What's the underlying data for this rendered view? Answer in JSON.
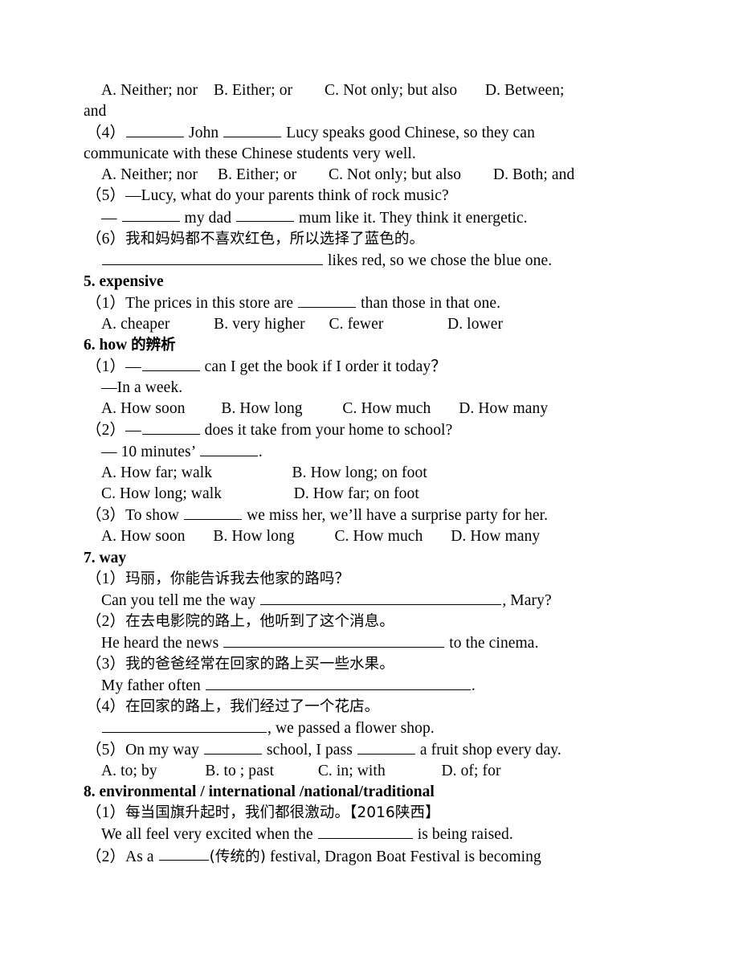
{
  "document": {
    "type": "english-grammar-worksheet",
    "lines": [
      {
        "id": "l1",
        "kind": "options",
        "text": "A. Neither; nor    B. Either; or        C. Not only; but also       D. Between;"
      },
      {
        "id": "l2",
        "kind": "wrap",
        "text": "and"
      },
      {
        "id": "l3",
        "kind": "item",
        "num": "（4）",
        "pre": "",
        "mid": " John ",
        "post": " Lucy speaks good Chinese, so they can"
      },
      {
        "id": "l4",
        "kind": "wrap",
        "text": "communicate with these Chinese students very well."
      },
      {
        "id": "l5",
        "kind": "options",
        "text": "A. Neither; nor     B. Either; or        C. Not only; but also        D. Both; and"
      },
      {
        "id": "l6",
        "kind": "item",
        "num": "（5）",
        "text": "—Lucy, what do your parents think of rock music?"
      },
      {
        "id": "l7",
        "kind": "dialog",
        "pre": "— ",
        "mid": " my dad ",
        "post": " mum like it. They think it energetic."
      },
      {
        "id": "l8",
        "kind": "item-cjk",
        "num": "（6）",
        "text": "我和妈妈都不喜欢红色，所以选择了蓝色的。"
      },
      {
        "id": "l9",
        "kind": "blank-answer",
        "post": " likes red, so we chose the blue one."
      },
      {
        "id": "h5",
        "kind": "heading",
        "text": "5. expensive"
      },
      {
        "id": "l10",
        "kind": "item",
        "num": "（1）",
        "pre": "The prices in this store are ",
        "post": " than those in that one."
      },
      {
        "id": "l11",
        "kind": "options",
        "text": "A. cheaper           B. very higher      C. fewer                D. lower"
      },
      {
        "id": "h6",
        "kind": "heading-mixed",
        "en": "6. how ",
        "cjk": "的辨析"
      },
      {
        "id": "l12",
        "kind": "item",
        "num": "（1）",
        "pre": "—",
        "post": " can I get the book if I order it today？"
      },
      {
        "id": "l13",
        "kind": "cont",
        "text": "—In a week."
      },
      {
        "id": "l14",
        "kind": "options",
        "text": "A. How soon         B. How long          C. How much       D. How many"
      },
      {
        "id": "l15",
        "kind": "item",
        "num": "（2）",
        "pre": "—",
        "post": " does it take from your home to school?"
      },
      {
        "id": "l16",
        "kind": "cont-blank",
        "pre": "— 10 minutes’ ",
        "post": "."
      },
      {
        "id": "l17",
        "kind": "options",
        "text": "A. How far; walk                    B. How long; on foot"
      },
      {
        "id": "l18",
        "kind": "options",
        "text": "C. How long; walk                  D. How far; on foot"
      },
      {
        "id": "l19",
        "kind": "item",
        "num": "（3）",
        "pre": "To show ",
        "post": " we miss her, we’ll have a surprise party for her."
      },
      {
        "id": "l20",
        "kind": "options",
        "text": "A. How soon       B. How long          C. How much       D. How many"
      },
      {
        "id": "h7",
        "kind": "heading",
        "text": "7. way"
      },
      {
        "id": "l21",
        "kind": "item-cjk",
        "num": "（1）",
        "text": "玛丽，你能告诉我去他家的路吗？"
      },
      {
        "id": "l22",
        "kind": "cont-fill",
        "pre": "Can you tell me the way ",
        "post": ", Mary?"
      },
      {
        "id": "l23",
        "kind": "item-cjk",
        "num": "（2）",
        "text": "在去电影院的路上，他听到了这个消息。"
      },
      {
        "id": "l24",
        "kind": "cont-fill",
        "pre": "He heard the news ",
        "post": " to the cinema."
      },
      {
        "id": "l25",
        "kind": "item-cjk",
        "num": "（3）",
        "text": "我的爸爸经常在回家的路上买一些水果。"
      },
      {
        "id": "l26",
        "kind": "cont-fill",
        "pre": "My father often ",
        "post": "."
      },
      {
        "id": "l27",
        "kind": "item-cjk",
        "num": "（4）",
        "text": "在回家的路上，我们经过了一个花店。"
      },
      {
        "id": "l28",
        "kind": "blank-answer",
        "post": ", we passed a flower shop."
      },
      {
        "id": "l29",
        "kind": "item",
        "num": "（5）",
        "pre": "On my way ",
        "mid": " school, I pass ",
        "post": " a fruit shop every day."
      },
      {
        "id": "l30",
        "kind": "options",
        "text": "A. to; by            B. to ; past           C. in; with              D. of; for"
      },
      {
        "id": "h8",
        "kind": "heading",
        "text": "8. environmental / international /national/traditional"
      },
      {
        "id": "l31",
        "kind": "item-cjk",
        "num": "（1）",
        "text": "每当国旗升起时，我们都很激动。【2016陕西】"
      },
      {
        "id": "l32",
        "kind": "cont-fill",
        "pre": "We all feel very excited when the ",
        "post": " is being raised."
      },
      {
        "id": "l33",
        "kind": "item-mixed",
        "num": "（2）",
        "pre": "As a ",
        "cjk": "(传统的)",
        "post": " festival, Dragon Boat Festival is becoming"
      }
    ],
    "sections": [
      {
        "number": "5",
        "keyword": "expensive"
      },
      {
        "number": "6",
        "keyword": "how 的辨析"
      },
      {
        "number": "7",
        "keyword": "way"
      },
      {
        "number": "8",
        "keyword": "environmental / international /national/traditional"
      }
    ]
  },
  "text": {
    "l1": "A. Neither; nor    B. Either; or        C. Not only; but also       D. Between;",
    "l2": "and",
    "l3_num": "（4）",
    "l3_mid": " John ",
    "l3_post": " Lucy speaks good Chinese, so they can",
    "l4": "communicate with these Chinese students very well.",
    "l5": "A. Neither; nor     B. Either; or        C. Not only; but also        D. Both; and",
    "l6_num": "（5）",
    "l6_text": "—Lucy, what do your parents think of rock music?",
    "l7_pre": "— ",
    "l7_mid": " my dad ",
    "l7_post": " mum like it. They think it energetic.",
    "l8_num": "（6）",
    "l8_text": "我和妈妈都不喜欢红色，所以选择了蓝色的。",
    "l9_post": " likes red, so we chose the blue one.",
    "h5": "5. expensive",
    "l10_num": "（1）",
    "l10_pre": "The prices in this store are ",
    "l10_post": " than those in that one.",
    "l11": "A. cheaper           B. very higher      C. fewer                D. lower",
    "h6_en": "6. how ",
    "h6_cjk": "的辨析",
    "l12_num": "（1）",
    "l12_pre": "—",
    "l12_post": " can I get the book if I order it today？",
    "l13": "—In a week.",
    "l14": "A. How soon         B. How long          C. How much       D. How many",
    "l15_num": "（2）",
    "l15_pre": "—",
    "l15_post": " does it take from your home to school?",
    "l16_pre": "— 10 minutes’ ",
    "l16_post": ".",
    "l17": "A. How far; walk                    B. How long; on foot",
    "l18": "C. How long; walk                  D. How far; on foot",
    "l19_num": "（3）",
    "l19_pre": "To show ",
    "l19_post": " we miss her, we’ll have a surprise party for her.",
    "l20": "A. How soon       B. How long          C. How much       D. How many",
    "h7": "7. way",
    "l21_num": "（1）",
    "l21_text": "玛丽，你能告诉我去他家的路吗？",
    "l22_pre": "Can you tell me the way ",
    "l22_post": ", Mary?",
    "l23_num": "（2）",
    "l23_text": "在去电影院的路上，他听到了这个消息。",
    "l24_pre": "He heard the news ",
    "l24_post": " to the cinema.",
    "l25_num": "（3）",
    "l25_text": "我的爸爸经常在回家的路上买一些水果。",
    "l26_pre": "My father often ",
    "l26_post": ".",
    "l27_num": "（4）",
    "l27_text": "在回家的路上，我们经过了一个花店。",
    "l28_post": ", we passed a flower shop.",
    "l29_num": "（5）",
    "l29_pre": "On my way ",
    "l29_mid": " school, I pass ",
    "l29_post": " a fruit shop every day.",
    "l30": "A. to; by            B. to ; past           C. in; with              D. of; for",
    "h8": "8. environmental / international /national/traditional",
    "l31_num": "（1）",
    "l31_text": "每当国旗升起时，我们都很激动。【2016陕西】",
    "l32_pre": "We all feel very excited when the ",
    "l32_post": " is being raised.",
    "l33_num": "（2）",
    "l33_pre": "As a ",
    "l33_cjk": "(传统的)",
    "l33_post": " festival, Dragon Boat Festival is becoming"
  }
}
